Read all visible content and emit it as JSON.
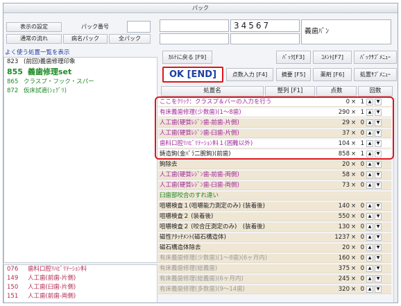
{
  "window": {
    "title": "パック"
  },
  "left": {
    "settings_button": "表示の設定",
    "pack_number_label": "パック番号",
    "pack_number_value": "",
    "normal_flow_button": "通常の流れ",
    "disease_pack_button": "病名パック",
    "all_pack_button": "全パック",
    "favorites_heading": "よく使う処置一覧を表示",
    "favorites": [
      {
        "code": "823",
        "name": "(前回)義歯修理印象",
        "style": "normal"
      },
      {
        "code": "855",
        "name": "義歯修理set",
        "style": "selected"
      },
      {
        "code": "865",
        "name": "クラスプ・フック・スパー",
        "style": "green"
      },
      {
        "code": "872",
        "name": "仮床試適(ｼｪｸﾞﾘ)",
        "style": "green"
      }
    ],
    "favorites2": [
      {
        "code": "076",
        "name": "歯科口腔ﾘﾊﾋﾞﾘﾃｰｼｮﾝ料"
      },
      {
        "code": "149",
        "name": "人工歯(前歯-片側)"
      },
      {
        "code": "150",
        "name": "人工歯(臼歯-片側)"
      },
      {
        "code": "151",
        "name": "人工歯(前歯-両側)"
      }
    ]
  },
  "right": {
    "top_field_2": "34567",
    "title_field": "義歯ﾊﾞﾝ",
    "buttons_row1": [
      "ｶﾙﾃに戻る [F9]",
      "ﾊﾟｯｸ[F3]",
      "ｺﾒﾝﾄ[F7]",
      "ﾊﾟｯｸｻﾌﾞﾒﾆｭｰ"
    ],
    "ok_button": "OK [END]",
    "buttons_row2": [
      "点数入力 [F4]",
      "摘要 [F5]",
      "薬剤 [F6]",
      "処置ｻﾌﾞﾒﾆｭｰ"
    ],
    "column_headers": {
      "name": "処置名",
      "sort": "整列 [F1]",
      "points": "点数",
      "count": "回数"
    },
    "up_arrow": "▲",
    "down_arrow": "▼",
    "rows": [
      {
        "name": "ここをｸﾘｯｸ：クラスプ＆バーの入力を行う",
        "points": "0",
        "x": "×",
        "count": "1",
        "color": "purple",
        "bg": "white"
      },
      {
        "name": "有床義歯修理(少数歯)(1～8歯)",
        "points": "290",
        "x": "×",
        "count": "1",
        "color": "purple",
        "bg": "white"
      },
      {
        "name": "人工歯(硬質ﾚｼﾞﾝ歯-前歯-片側)",
        "points": "29",
        "x": "×",
        "count": "0",
        "color": "purple",
        "bg": "tan"
      },
      {
        "name": "人工歯(硬質ﾚｼﾞﾝ歯-臼歯-片側)",
        "points": "37",
        "x": "×",
        "count": "0",
        "color": "purple",
        "bg": "tan"
      },
      {
        "name": "歯科口腔ﾘﾊﾋﾞﾘﾃｰｼｮﾝ料１(困難以外)",
        "points": "104",
        "x": "×",
        "count": "1",
        "color": "purple",
        "bg": "white"
      },
      {
        "name": "鋳造鉤(金ﾊﾟﾗ二腕鉤)(前歯)",
        "points": "858",
        "x": "×",
        "count": "1",
        "color": "dark",
        "bg": "white"
      },
      {
        "name": "鉤除去",
        "points": "20",
        "x": "×",
        "count": "0",
        "color": "dark",
        "bg": "tan"
      },
      {
        "name": "人工歯(硬質ﾚｼﾞﾝ歯-前歯-両側)",
        "points": "58",
        "x": "×",
        "count": "0",
        "color": "purple",
        "bg": "tan"
      },
      {
        "name": "人工歯(硬質ﾚｼﾞﾝ歯-臼歯-両側)",
        "points": "73",
        "x": "×",
        "count": "0",
        "color": "purple",
        "bg": "tan"
      },
      {
        "name": "臼歯部咬合のすれ違い",
        "points": "",
        "x": "",
        "count": "",
        "color": "green",
        "bg": "tan"
      },
      {
        "name": "咀嚼検査１(咀嚼能力測定のみ) (装着後)",
        "points": "140",
        "x": "×",
        "count": "0",
        "color": "dark",
        "bg": "tan"
      },
      {
        "name": "咀嚼検査２ (装着後)",
        "points": "550",
        "x": "×",
        "count": "0",
        "color": "dark",
        "bg": "tan"
      },
      {
        "name": "咀嚼検査２ (咬合圧測定のみ)　(装着後)",
        "points": "130",
        "x": "×",
        "count": "0",
        "color": "dark",
        "bg": "tan"
      },
      {
        "name": "磁性ｱﾀｯﾁﾒﾝﾄ(磁石構造体)",
        "points": "1237",
        "x": "×",
        "count": "0",
        "color": "dark",
        "bg": "tan"
      },
      {
        "name": "磁石構造体除去",
        "points": "20",
        "x": "×",
        "count": "0",
        "color": "dark",
        "bg": "tan"
      },
      {
        "name": "有床義歯修理(少数歯)(1～8歯)(6ヶ月内)",
        "points": "160",
        "x": "×",
        "count": "0",
        "color": "gray",
        "bg": "tan"
      },
      {
        "name": "有床義歯修理(総義歯)",
        "points": "375",
        "x": "×",
        "count": "0",
        "color": "gray",
        "bg": "tan"
      },
      {
        "name": "有床義歯修理(総義歯)(6ヶ月内)",
        "points": "245",
        "x": "×",
        "count": "0",
        "color": "gray",
        "bg": "tan"
      },
      {
        "name": "有床義歯修理(多数歯)(9～14歯)",
        "points": "320",
        "x": "×",
        "count": "0",
        "color": "gray",
        "bg": "tan"
      }
    ]
  }
}
